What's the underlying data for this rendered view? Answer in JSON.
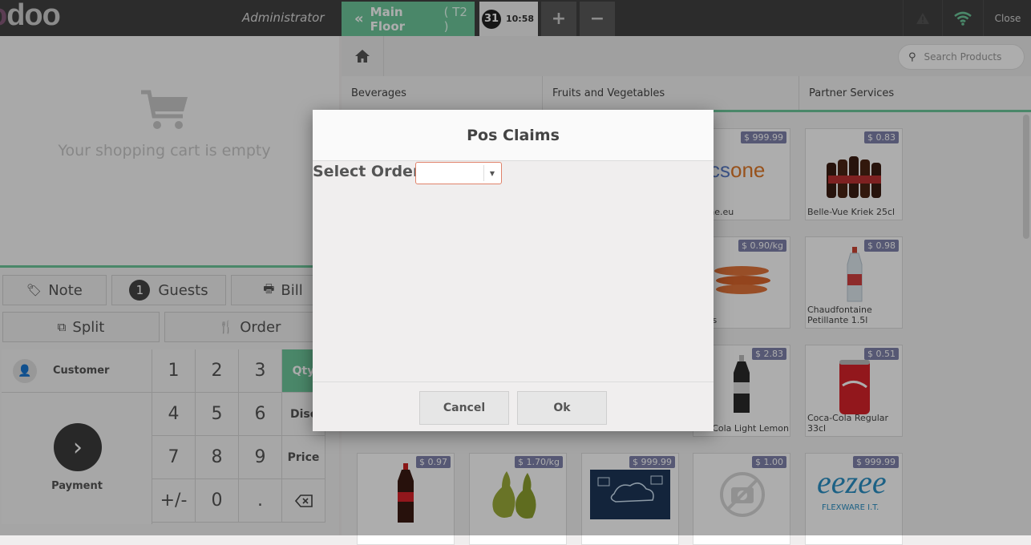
{
  "topbar": {
    "logo": "odoo",
    "username": "Administrator",
    "floor_label": "Main Floor",
    "table_label": "( T2 )",
    "order_number": "31",
    "order_time": "10:58",
    "add_icon": "plus-icon",
    "remove_icon": "minus-icon",
    "warning_icon": "warning-icon",
    "wifi_icon": "wifi-icon",
    "close_label": "Close"
  },
  "cart": {
    "empty_text": "Your shopping cart is empty",
    "icon": "shopping-cart-icon"
  },
  "controls": {
    "note_label": "Note",
    "guests_count": "1",
    "guests_label": "Guests",
    "bill_label": "Bill",
    "split_label": "Split",
    "order_label": "Order"
  },
  "numpad": {
    "customer_label": "Customer",
    "payment_label": "Payment",
    "keys": [
      "1",
      "2",
      "3",
      "4",
      "5",
      "6",
      "7",
      "8",
      "9",
      "+/-",
      "0",
      "."
    ],
    "mode_qty": "Qty",
    "mode_disc": "Disc",
    "mode_price": "Price",
    "backspace_icon": "backspace-icon"
  },
  "products_header": {
    "search_placeholder": "Search Products",
    "categories": [
      "Beverages",
      "Fruits and Vegetables",
      "Partner Services"
    ]
  },
  "products": [
    {
      "price": "$ 999.99",
      "name": "...one.eu"
    },
    {
      "price": "$ 0.83",
      "name": "Belle-Vue Kriek 25cl"
    },
    {
      "price": "$ 0.90/kg",
      "name": "...ots"
    },
    {
      "price": "$ 0.98",
      "name": "Chaudfontaine Petillante 1.5l"
    },
    {
      "price": "$ 2.83",
      "name": "...a-Cola Light Lemon"
    },
    {
      "price": "$ 0.51",
      "name": "Coca-Cola Regular 33cl"
    },
    {
      "price": "$ 0.97",
      "name": ""
    },
    {
      "price": "$ 1.70/kg",
      "name": ""
    },
    {
      "price": "$ 999.99",
      "name": ""
    },
    {
      "price": "$ 1.00",
      "name": ""
    },
    {
      "price": "$ 999.99",
      "name": ""
    }
  ],
  "dialog": {
    "title": "Pos Claims",
    "field_label": "Select Order :",
    "select_value": "",
    "cancel_label": "Cancel",
    "ok_label": "Ok"
  },
  "colors": {
    "accent_green": "#6ec89b",
    "topbar_bg": "#414141",
    "price_tag": "#7f82ac"
  }
}
